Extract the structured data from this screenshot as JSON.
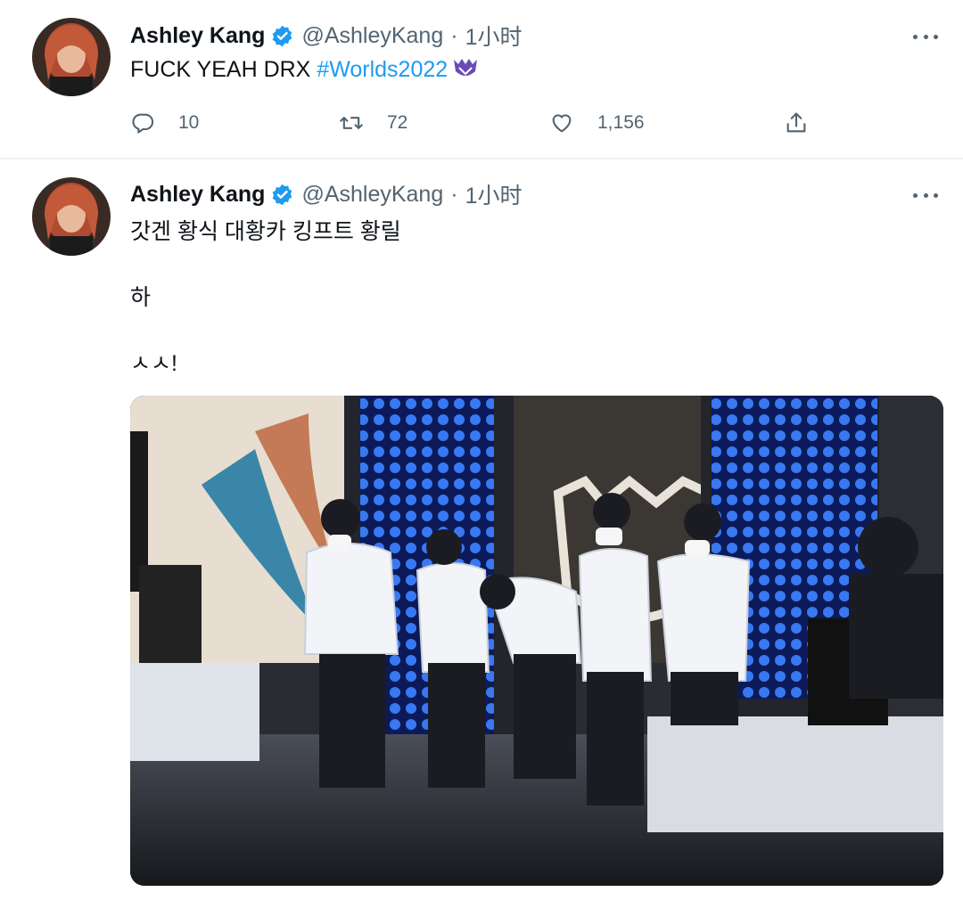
{
  "tweets": [
    {
      "author_name": "Ashley Kang",
      "handle": "@AshleyKang",
      "separator": "·",
      "time": "1小时",
      "text": "FUCK YEAH DRX ",
      "hashtag": "#Worlds2022",
      "stats": {
        "replies": "10",
        "retweets": "72",
        "likes": "1,156"
      }
    },
    {
      "author_name": "Ashley Kang",
      "handle": "@AshleyKang",
      "separator": "·",
      "time": "1小时",
      "lines": [
        "갓겐 황식 대황카 킹프트 황릴",
        "하",
        "ㅅㅅ!"
      ]
    }
  ],
  "icons": {
    "verified": "verified-badge-icon",
    "more": "more-options-icon",
    "reply": "reply-icon",
    "retweet": "retweet-icon",
    "like": "like-icon",
    "share": "share-icon",
    "emblem": "worlds-emblem-icon"
  },
  "colors": {
    "accent": "#1d9bf0",
    "muted": "#536471",
    "text": "#0f1419",
    "divider": "#eff3f4"
  }
}
